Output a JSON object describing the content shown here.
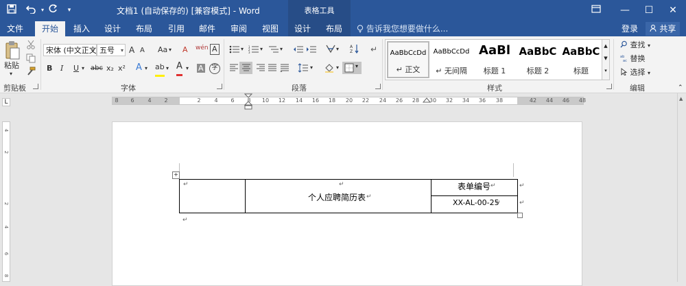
{
  "window": {
    "title": "文档1 (自动保存的) [兼容模式] - Word",
    "context_tools_title": "表格工具"
  },
  "quick_access": {
    "save_icon": "save-icon",
    "undo_icon": "undo-icon",
    "redo_icon": "redo-icon",
    "customize_icon": "customize-qat-icon"
  },
  "window_controls": {
    "ribbon_options_icon": "ribbon-display-options-icon",
    "minimize": "—",
    "maximize": "☐",
    "close": "✕"
  },
  "tabs": [
    {
      "label": "文件"
    },
    {
      "label": "开始"
    },
    {
      "label": "插入"
    },
    {
      "label": "设计"
    },
    {
      "label": "布局"
    },
    {
      "label": "引用"
    },
    {
      "label": "邮件"
    },
    {
      "label": "审阅"
    },
    {
      "label": "视图"
    },
    {
      "label": "设计"
    },
    {
      "label": "布局"
    }
  ],
  "tell_me": "告诉我您想要做什么...",
  "account": {
    "signin": "登录",
    "share": "共享"
  },
  "clipboard": {
    "paste_label": "粘贴",
    "group_label": "剪贴板"
  },
  "font": {
    "font_name": "宋体 (中文正文",
    "font_size": "五号",
    "grow": "A",
    "shrink": "A",
    "change_case": "Aa",
    "clear_format": "A",
    "phonetic": "wén",
    "border_char": "A",
    "bold": "B",
    "italic": "I",
    "underline": "U",
    "strike": "abc",
    "subscript": "x₂",
    "superscript": "x²",
    "text_effects": "A",
    "highlight": "ab",
    "font_color": "A",
    "char_shading": "A",
    "enclose": "字",
    "group_label": "字体"
  },
  "paragraph": {
    "group_label": "段落"
  },
  "styles": {
    "items": [
      {
        "preview": "AaBbCcDd",
        "name": "↵ 正文"
      },
      {
        "preview": "AaBbCcDd",
        "name": "↵ 无间隔"
      },
      {
        "preview": "AaBl",
        "name": "标题 1"
      },
      {
        "preview": "AaBbC",
        "name": "标题 2"
      },
      {
        "preview": "AaBbC",
        "name": "标题"
      }
    ],
    "group_label": "样式"
  },
  "editing": {
    "find": "查找",
    "replace": "替换",
    "select": "选择",
    "group_label": "编辑"
  },
  "ruler": {
    "h_numbers": [
      "8",
      "6",
      "4",
      "2",
      "2",
      "4",
      "6",
      "8",
      "10",
      "12",
      "14",
      "16",
      "18",
      "20",
      "22",
      "24",
      "26",
      "28",
      "30",
      "32",
      "34",
      "36",
      "38",
      "42",
      "44",
      "46",
      "48"
    ],
    "v_numbers": [
      "4",
      "2",
      "2",
      "4",
      "6",
      "8"
    ],
    "tab_selector": "L"
  },
  "document": {
    "table": {
      "title_cell": "个人应聘简历表",
      "form_no_label": "表单编号",
      "form_no_value": "XX-AL-00-25"
    },
    "paragraph_mark": "↵",
    "cell_mark": "↵"
  },
  "colors": {
    "accent": "#2b579a",
    "ribbon_bg": "#f3f3f3",
    "canvas_bg": "#e6e6e6"
  }
}
